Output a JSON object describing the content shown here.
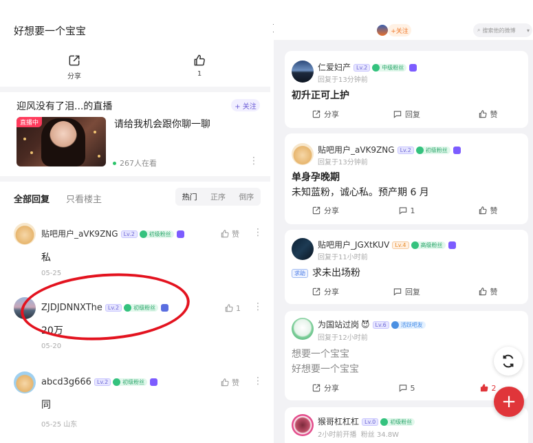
{
  "colors": {
    "accent_red": "#e0353a",
    "fan_green": "#34c27e",
    "level_purple": "#6b66d6",
    "annotation_red": "#e3131f"
  },
  "left": {
    "post_title": "好想要一个宝宝",
    "share_label": "分享",
    "like_count": "1",
    "live": {
      "title": "迎风没有了泪...的直播",
      "follow_label": "+ 关注",
      "badge": "直播中",
      "text": "请给我机会跟你聊一聊",
      "viewers": "267人在看"
    },
    "tabs": {
      "all": "全部回复",
      "op_only": "只看楼主"
    },
    "sort": {
      "hot": "热门",
      "asc": "正序",
      "desc": "倒序"
    },
    "replies": [
      {
        "name": "贴吧用户_aVK9ZNG",
        "level": "Lv.2",
        "fan": "初级粉丝",
        "text": "私",
        "meta": "05-25",
        "like": "赞"
      },
      {
        "name": "ZJDJDNNXThe",
        "level": "Lv.2",
        "fan": "初级粉丝",
        "text": "20万",
        "meta": "05-20",
        "like": "1"
      },
      {
        "name": "abcd3g666",
        "level": "Lv.2",
        "fan": "初级粉丝",
        "text": "同",
        "meta": "05-25 山东",
        "like": "赞"
      }
    ]
  },
  "right": {
    "bracket": "]",
    "top_follow": "+关注",
    "search_placeholder": "搜索他的微博",
    "cards": [
      {
        "name": "仁爱妇产",
        "level": "Lv.2",
        "fan": "中级粉丝",
        "time": "回复于13分钟前",
        "title": "初升正可上护",
        "body": "",
        "share": "分享",
        "reply": "回复",
        "like": "赞"
      },
      {
        "name": "贴吧用户_aVK9ZNG",
        "level": "Lv.2",
        "fan": "初级粉丝",
        "time": "回复于13分钟前",
        "title": "单身孕晚期",
        "body": "未知蓝粉，诚心私。预产期 6 月",
        "share": "分享",
        "reply": "1",
        "like": "赞"
      },
      {
        "name": "贴吧用户_JGXtKUV",
        "level": "Lv.4",
        "fan": "高级粉丝",
        "time": "回复于11小时前",
        "tag": "求助",
        "title": "求未出场粉",
        "share": "分享",
        "reply": "回复",
        "like": "赞"
      },
      {
        "name": "为国站过岗",
        "level": "Lv.6",
        "fan": "活跃吧友",
        "time": "回复于12小时前",
        "line1": "想要一个宝宝",
        "line2": "好想要一个宝宝",
        "share": "分享",
        "reply": "5",
        "like": "2"
      },
      {
        "name": "猴哥杠杠杠",
        "level": "Lv.0",
        "fan": "初级粉丝",
        "time": "2小时前开播",
        "fans": "粉丝 34.8W"
      }
    ]
  }
}
